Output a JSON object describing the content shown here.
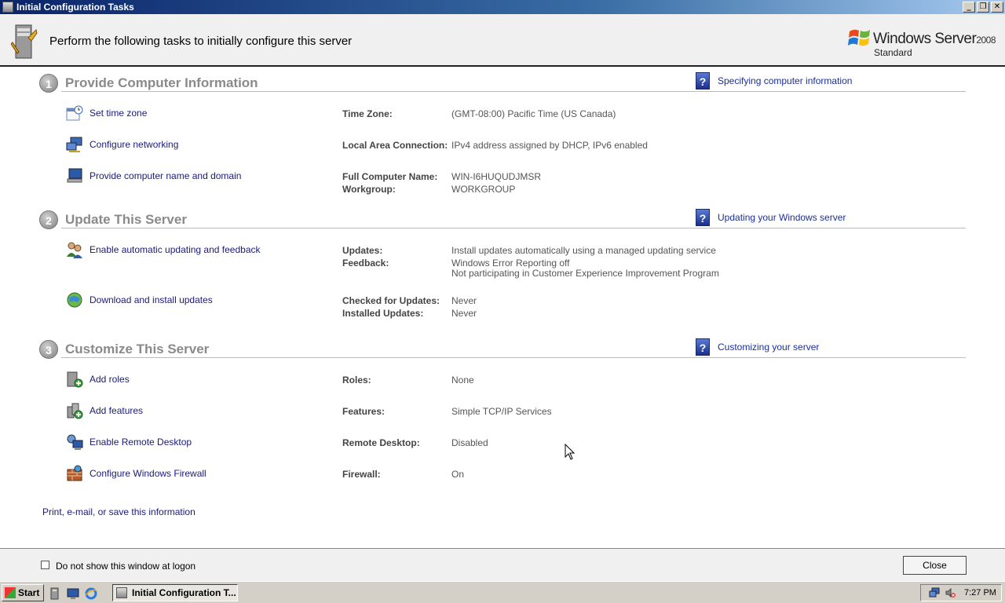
{
  "window": {
    "title": "Initial Configuration Tasks",
    "buttons": {
      "minimize": "_",
      "restore": "❐",
      "close": "✕"
    }
  },
  "header": {
    "text": "Perform the following tasks to initially configure this server",
    "brand_name": "Windows Server",
    "brand_year": "2008",
    "brand_edition": "Standard"
  },
  "sections": [
    {
      "number": "1",
      "title": "Provide Computer Information",
      "help_text": "Specifying computer information",
      "tasks": [
        {
          "label": "Set time zone",
          "icon": "clock-calendar-icon"
        },
        {
          "label": "Configure networking",
          "icon": "network-icon"
        },
        {
          "label": "Provide computer name and domain",
          "icon": "computer-icon"
        }
      ],
      "fields": [
        {
          "label": "Time Zone:",
          "value": "(GMT-08:00) Pacific Time (US  Canada)"
        },
        {
          "label": "Local Area Connection:",
          "value": "IPv4 address assigned by DHCP, IPv6 enabled"
        },
        {
          "label": "Full Computer Name:",
          "value": "WIN-I6HUQUDJMSR"
        },
        {
          "label": "Workgroup:",
          "value": "WORKGROUP"
        }
      ]
    },
    {
      "number": "2",
      "title": "Update This Server",
      "help_text": "Updating your Windows server",
      "tasks": [
        {
          "label": "Enable automatic updating and feedback",
          "icon": "users-icon"
        },
        {
          "label": "Download and install updates",
          "icon": "update-globe-icon"
        }
      ],
      "fields": [
        {
          "label": "Updates:",
          "value": "Install updates automatically using a managed updating service"
        },
        {
          "label": "Feedback:",
          "value": "Windows Error Reporting off"
        },
        {
          "label": "",
          "value": "Not participating in Customer Experience Improvement Program"
        },
        {
          "label": "Checked for Updates:",
          "value": "Never"
        },
        {
          "label": "Installed Updates:",
          "value": "Never"
        }
      ]
    },
    {
      "number": "3",
      "title": "Customize This Server",
      "help_text": "Customizing your server",
      "tasks": [
        {
          "label": "Add roles",
          "icon": "add-roles-icon"
        },
        {
          "label": "Add features",
          "icon": "add-features-icon"
        },
        {
          "label": "Enable Remote Desktop",
          "icon": "remote-desktop-icon"
        },
        {
          "label": "Configure Windows Firewall",
          "icon": "firewall-icon"
        }
      ],
      "fields": [
        {
          "label": "Roles:",
          "value": "None"
        },
        {
          "label": "Features:",
          "value": "Simple TCP/IP Services"
        },
        {
          "label": "Remote Desktop:",
          "value": "Disabled"
        },
        {
          "label": "Firewall:",
          "value": "On"
        }
      ]
    }
  ],
  "print_link": "Print, e-mail, or save this information",
  "footer": {
    "checkbox_label": "Do not show this window at logon",
    "checkbox_checked": false,
    "close_label": "Close"
  },
  "taskbar": {
    "start_label": "Start",
    "task_label": "Initial Configuration T...",
    "clock": "7:27 PM"
  },
  "colors": {
    "link": "#1a1a7a",
    "section_title": "#8a8a8a",
    "titlebar_start": "#0a246a"
  }
}
